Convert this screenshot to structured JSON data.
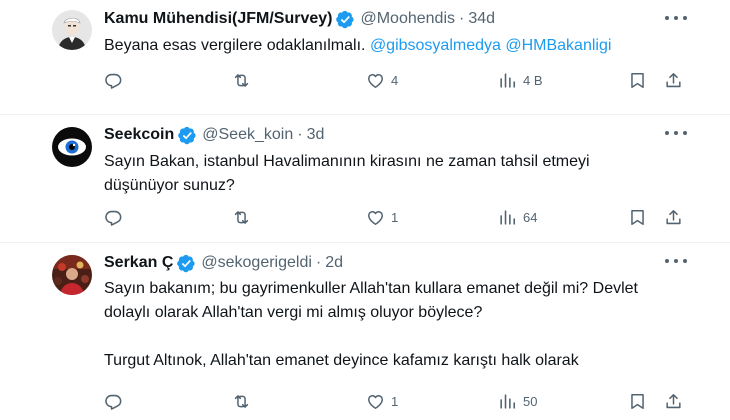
{
  "icons": [
    "verified-badge-icon",
    "more-icon",
    "reply-icon",
    "retweet-icon",
    "like-icon",
    "views-icon",
    "bookmark-icon",
    "share-icon"
  ],
  "colors": {
    "accent": "#1d9bf0",
    "text": "#0f1419",
    "secondary": "#536471",
    "divider": "#eff3f4"
  },
  "tweets": [
    {
      "name": "Kamu Mühendisi(JFM/Survey)",
      "handle": "@Moohendis",
      "time": "34d",
      "text_plain": "Beyana esas vergilere odaklanılmalı.",
      "mention1": "@gibsosyalmedya",
      "mention2": "@HMBakanligi",
      "replies": "",
      "retweets": "",
      "likes": "4",
      "views": "4 B"
    },
    {
      "name": "Seekcoin",
      "handle": "@Seek_koin",
      "time": "3d",
      "line1": "Sayın Bakan, istanbul Havalimanının kirasını ne zaman tahsil etmeyi",
      "line2": "düşünüyor sunuz?",
      "replies": "",
      "retweets": "",
      "likes": "1",
      "views": "64"
    },
    {
      "name": "Serkan Ç",
      "handle": "@sekogerigeldi",
      "time": "2d",
      "line1": "Sayın bakanım; bu gayrimenkuller Allah'tan kullara emanet değil mi? Devlet",
      "line2": "dolaylı olarak Allah'tan vergi mi almış oluyor böylece?",
      "line3": "Turgut Altınok, Allah'tan emanet deyince kafamız karıştı halk olarak",
      "replies": "",
      "retweets": "",
      "likes": "1",
      "views": "50"
    }
  ]
}
